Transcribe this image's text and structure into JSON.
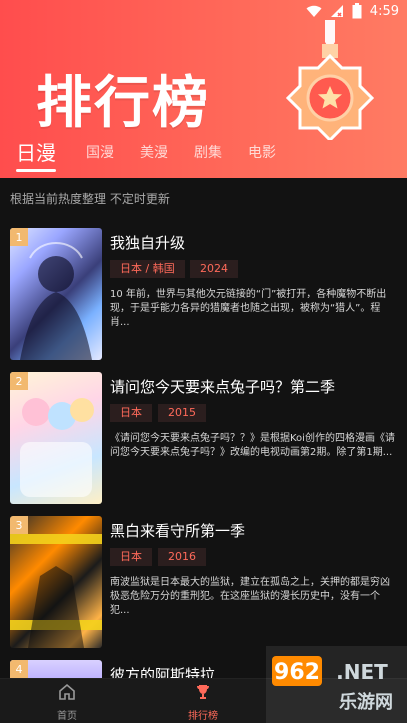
{
  "statusbar": {
    "time": "4:59"
  },
  "hero": {
    "title": "排行榜"
  },
  "tabs": [
    {
      "label": "日漫",
      "active": true
    },
    {
      "label": "国漫",
      "active": false
    },
    {
      "label": "美漫",
      "active": false
    },
    {
      "label": "剧集",
      "active": false
    },
    {
      "label": "电影",
      "active": false
    }
  ],
  "subtitle": "根据当前热度整理 不定时更新",
  "items": [
    {
      "rank": "1",
      "title": "我独自升级",
      "chips": [
        "日本 / 韩国",
        "2024"
      ],
      "desc": "10 年前，世界与其他次元链接的“门”被打开，各种魔物不断出现，于是乎能力各异的猎魔者也随之出现，被称为“猎人”。程肖..."
    },
    {
      "rank": "2",
      "title": "请问您今天要来点兔子吗？第二季",
      "chips": [
        "日本",
        "2015"
      ],
      "desc": "《请问您今天要来点兔子吗？？》是根据Koi创作的四格漫画《请问您今天要来点兔子吗？》改编的电视动画第2期。除了第1期..."
    },
    {
      "rank": "3",
      "title": "黑白来看守所第一季",
      "chips": [
        "日本",
        "2016"
      ],
      "desc": "南波监狱是日本最大的监狱，建立在孤岛之上，关押的都是穷凶极恶危险万分的重刑犯。在这座监狱的漫长历史中，没有一个犯..."
    },
    {
      "rank": "4",
      "title": "彼方的阿斯特拉",
      "chips": [],
      "desc": ""
    }
  ],
  "nav": {
    "home_label": "首页",
    "rank_label": "排行榜"
  },
  "watermark": "962.NET 乐游网",
  "colors": {
    "accent": "#ff4d4d",
    "chip_text": "#ff6a5a",
    "nav_active": "#ff6a5a"
  }
}
